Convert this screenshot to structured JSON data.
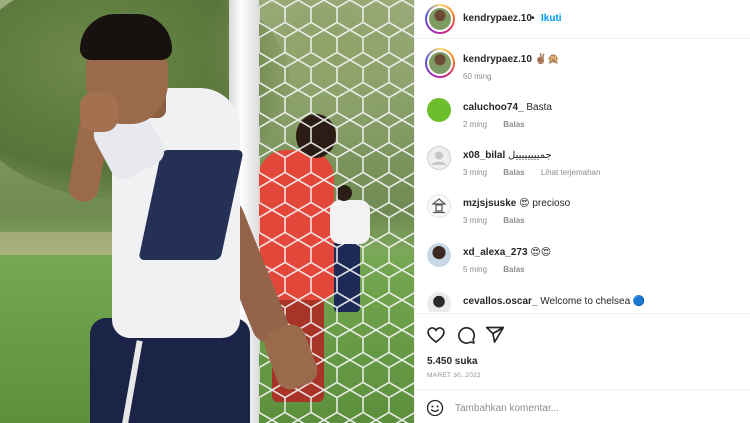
{
  "post": {
    "photo_icon": "photo-of-footballer-peace-sign"
  },
  "header": {
    "username": "kendrypaez.10",
    "separator": "•",
    "follow_label": "Ikuti"
  },
  "caption": {
    "username": "kendrypaez.10",
    "text": "✌🏽🙊",
    "time": "60 ming"
  },
  "comments": [
    {
      "username": "caluchoo74_",
      "text": "Basta",
      "time": "2 ming",
      "reply_label": "Balas",
      "translate_label": ""
    },
    {
      "username": "x08_bilal",
      "text": "جمييييييييل",
      "time": "3 ming",
      "reply_label": "Balas",
      "translate_label": "Lihat terjemahan"
    },
    {
      "username": "mzjsjsuske",
      "text": "😍 precioso",
      "time": "3 ming",
      "reply_label": "Balas",
      "translate_label": ""
    },
    {
      "username": "xd_alexa_273",
      "text": "😍😍",
      "time": "5 ming",
      "reply_label": "Balas",
      "translate_label": ""
    },
    {
      "username": "cevallos.oscar_",
      "text": "Welcome to chelsea 🔵",
      "time": "",
      "reply_label": "",
      "translate_label": ""
    }
  ],
  "actions": {
    "like_icon": "heart-icon",
    "comment_icon": "comment-icon",
    "share_icon": "share-icon"
  },
  "likes": "5.450 suka",
  "date": "MARET 30, 2022",
  "add_comment": {
    "emoji_icon": "smiley-icon",
    "placeholder": "Tambahkan komentar..."
  },
  "colors": {
    "accent": "#0095f6",
    "muted": "#8e8e8e",
    "text": "#262626",
    "caluchoo_avatar": "#6cbe2c"
  }
}
